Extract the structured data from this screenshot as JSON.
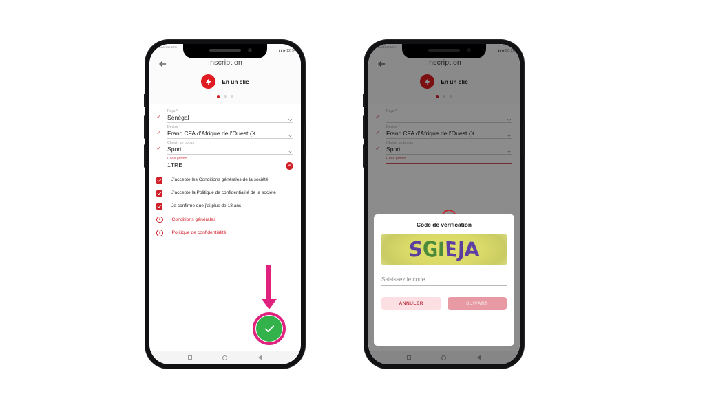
{
  "left_phone": {
    "status_bar": {
      "carrier": "MOOV AFRIC MTN",
      "time": "12:54",
      "icons": "▮▮▰"
    },
    "appbar": {
      "back_icon": "back-arrow-icon",
      "title": "Inscription"
    },
    "brand": {
      "icon": "lightning-bolt-icon",
      "label": "En un clic"
    },
    "carousel": {
      "total": 3,
      "active_index": 0
    },
    "fields": [
      {
        "check": "✓",
        "label": "Pays *",
        "value": "Sénégal",
        "chevron": "chevron-down-icon",
        "redacted": false,
        "underlined": false,
        "promo": false,
        "badge": null
      },
      {
        "check": "✓",
        "label": "Devise *",
        "value": "Franc CFA d'Afrique de l'Ouest (X",
        "chevron": "chevron-down-icon",
        "redacted": false,
        "underlined": false,
        "promo": false,
        "badge": null
      },
      {
        "check": "✓",
        "label": "Choisir un bonus",
        "value": "Sport",
        "chevron": "chevron-down-icon",
        "redacted": false,
        "underlined": false,
        "promo": false,
        "badge": null
      },
      {
        "check": "",
        "label": "Code promo",
        "value": "1TRE",
        "chevron": null,
        "redacted": false,
        "underlined": true,
        "promo": true,
        "badge": "4"
      }
    ],
    "checkboxes": [
      {
        "checked": true,
        "text": "J'accepte les Conditions générales de la société"
      },
      {
        "checked": true,
        "text": "J'accepte la Politique de confidentialité de la société"
      },
      {
        "checked": true,
        "text": "Je confirme que j'ai plus de 18 ans"
      }
    ],
    "links": [
      {
        "icon": "info-icon",
        "text": "Conditions générales"
      },
      {
        "icon": "info-icon",
        "text": "Politique de confidentialité"
      }
    ],
    "submit_fab": {
      "icon": "check-icon",
      "label": ""
    },
    "navbar": {
      "recents": "square-icon",
      "home": "circle-icon",
      "back": "triangle-back-icon"
    }
  },
  "right_phone": {
    "status_bar": {
      "carrier": "MOOV AFRIC MTN",
      "time": "00:20",
      "icons": "▮▮▰"
    },
    "appbar": {
      "back_icon": "back-arrow-icon",
      "title": "Inscription"
    },
    "brand": {
      "icon": "lightning-bolt-icon",
      "label": "En un clic"
    },
    "carousel": {
      "total": 3,
      "active_index": 0
    },
    "fields": [
      {
        "check": "✓",
        "label": "Pays *",
        "value": "",
        "chevron": "chevron-down-icon",
        "redacted": true,
        "underlined": false,
        "promo": false,
        "badge": null
      },
      {
        "check": "✓",
        "label": "Devise *",
        "value": "Franc CFA d'Afrique de l'Ouest (X",
        "chevron": "chevron-down-icon",
        "redacted": false,
        "underlined": false,
        "promo": false,
        "badge": null
      },
      {
        "check": "✓",
        "label": "Choisir un bonus",
        "value": "Sport",
        "chevron": "chevron-down-icon",
        "redacted": false,
        "underlined": false,
        "promo": false,
        "badge": null
      },
      {
        "check": "",
        "label": "Code promo",
        "value": "",
        "chevron": null,
        "redacted": false,
        "underlined": true,
        "promo": true,
        "badge": null
      }
    ],
    "loading_spinner": "loading-spinner-icon",
    "dialog": {
      "title": "Code de vérification",
      "captcha_text": "SGIEJA",
      "input_placeholder": "Saisissez le code",
      "input_value": "",
      "cancel_label": "ANNULER",
      "next_label": "SUIVANT"
    },
    "navbar": {
      "recents": "square-icon",
      "home": "circle-icon",
      "back": "triangle-back-icon"
    }
  },
  "annotations": {
    "arrow": "down-arrow-annotation",
    "highlight_circle": "circle-highlight-annotation",
    "accent_color": "#e0217d",
    "brand_color": "#d0202a",
    "success_color": "#33b24c"
  }
}
